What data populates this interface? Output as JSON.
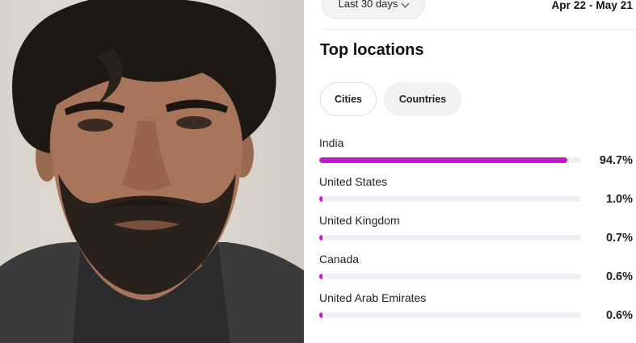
{
  "filter": {
    "range_label": "Last 30 days",
    "range_icon": "chevron-down-icon",
    "date_range": "Apr 22 - May 21"
  },
  "section": {
    "title": "Top locations"
  },
  "tabs": [
    {
      "label": "Cities",
      "selected": true
    },
    {
      "label": "Countries",
      "selected": false
    }
  ],
  "accent_color": "#c119c9",
  "locations": [
    {
      "name": "India",
      "percent_label": "94.7%",
      "fraction": 0.947
    },
    {
      "name": "United States",
      "percent_label": "1.0%",
      "fraction": 0.01
    },
    {
      "name": "United Kingdom",
      "percent_label": "0.7%",
      "fraction": 0.007
    },
    {
      "name": "Canada",
      "percent_label": "0.6%",
      "fraction": 0.006
    },
    {
      "name": "United Arab Emirates",
      "percent_label": "0.6%",
      "fraction": 0.006
    }
  ]
}
